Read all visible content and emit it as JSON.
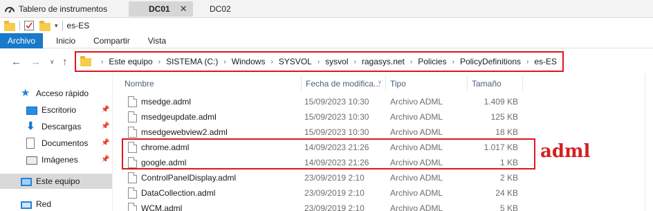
{
  "tabs": [
    {
      "label": "Tablero de instrumentos",
      "icon": "dashboard-icon"
    },
    {
      "label": "DC01",
      "icon": "windows-logo-icon",
      "active": true,
      "close": "✕"
    },
    {
      "label": "DC02",
      "icon": "windows-logo-icon"
    }
  ],
  "qat": {
    "title": "es-ES"
  },
  "ribbon": {
    "file": "Archivo",
    "home": "Inicio",
    "share": "Compartir",
    "view": "Vista"
  },
  "address": {
    "crumbs": [
      "Este equipo",
      "SISTEMA (C:)",
      "Windows",
      "SYSVOL",
      "sysvol",
      "ragasys.net",
      "Policies",
      "PolicyDefinitions",
      "es-ES"
    ]
  },
  "sidebar": {
    "quick_access": "Acceso rápido",
    "items": [
      "Escritorio",
      "Descargas",
      "Documentos",
      "Imágenes"
    ],
    "this_pc": "Este equipo",
    "network": "Red"
  },
  "columns": {
    "name": "Nombre",
    "date": "Fecha de modifica...",
    "type": "Tipo",
    "size": "Tamaño"
  },
  "files": [
    {
      "name": "msedge.adml",
      "date": "15/09/2023 10:30",
      "type": "Archivo ADML",
      "size": "1.409 KB"
    },
    {
      "name": "msedgeupdate.adml",
      "date": "15/09/2023 10:30",
      "type": "Archivo ADML",
      "size": "125 KB"
    },
    {
      "name": "msedgewebview2.adml",
      "date": "15/09/2023 10:30",
      "type": "Archivo ADML",
      "size": "18 KB"
    },
    {
      "name": "chrome.adml",
      "date": "14/09/2023 21:26",
      "type": "Archivo ADML",
      "size": "1.017 KB"
    },
    {
      "name": "google.adml",
      "date": "14/09/2023 21:26",
      "type": "Archivo ADML",
      "size": "1 KB"
    },
    {
      "name": "ControlPanelDisplay.adml",
      "date": "23/09/2019 2:10",
      "type": "Archivo ADML",
      "size": "2 KB"
    },
    {
      "name": "DataCollection.adml",
      "date": "23/09/2019 2:10",
      "type": "Archivo ADML",
      "size": "24 KB"
    },
    {
      "name": "WCM.adml",
      "date": "23/09/2019 2:10",
      "type": "Archivo ADML",
      "size": "5 KB"
    }
  ],
  "annotation": "adml",
  "colors": {
    "highlight": "#e0141e",
    "ribbon_file": "#1979ca",
    "folder": "#f7cb4d"
  }
}
